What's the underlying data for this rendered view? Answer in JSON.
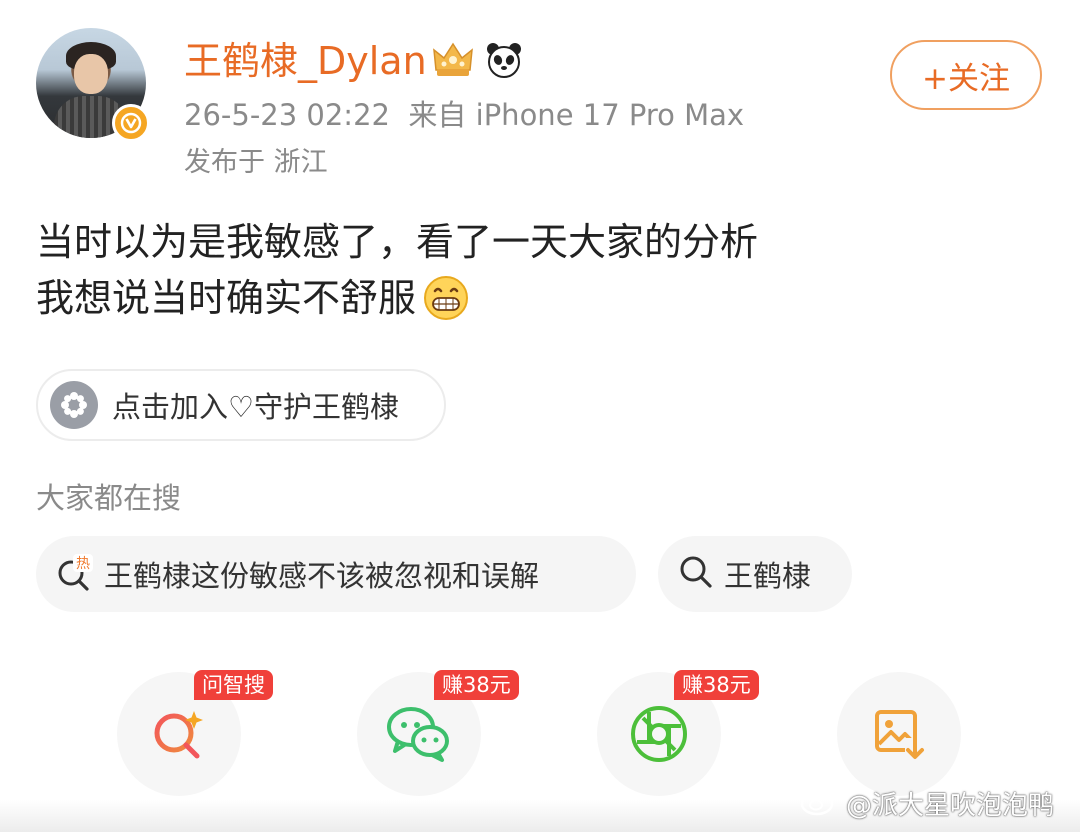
{
  "post": {
    "author": {
      "name": "王鹤棣_Dylan",
      "avatar": "avatar-photo",
      "verified_badge": "v-badge-icon",
      "badges": [
        "crown-icon",
        "panda-icon"
      ]
    },
    "time": "26-5-23 02:22",
    "source": "来自 iPhone 17 Pro Max",
    "location": "发布于 浙江",
    "follow_label": "+关注",
    "content_lines": [
      "当时以为是我敏感了，看了一天大家的分析",
      "我想说当时确实不舒服"
    ],
    "content_emoji": "grin-emoji-icon"
  },
  "join": {
    "label": "点击加入♡守护王鹤棣",
    "icon": "flower-icon"
  },
  "search": {
    "title": "大家都在搜",
    "chips": [
      {
        "icon": "hot-search-icon",
        "label": "王鹤棣这份敏感不该被忽视和误解"
      },
      {
        "icon": "search-icon",
        "label": "王鹤棣"
      }
    ]
  },
  "actions": [
    {
      "icon": "ai-search-icon",
      "tag": "问智搜"
    },
    {
      "icon": "wechat-icon",
      "tag": "赚38元"
    },
    {
      "icon": "moments-icon",
      "tag": "赚38元"
    },
    {
      "icon": "save-image-icon",
      "tag": ""
    }
  ],
  "watermark": "@派大星吹泡泡鸭",
  "colors": {
    "accent": "#e86b25",
    "tag_red": "#f0403a",
    "meta_gray": "#8a8a8a",
    "chip_bg": "#f5f5f5"
  }
}
